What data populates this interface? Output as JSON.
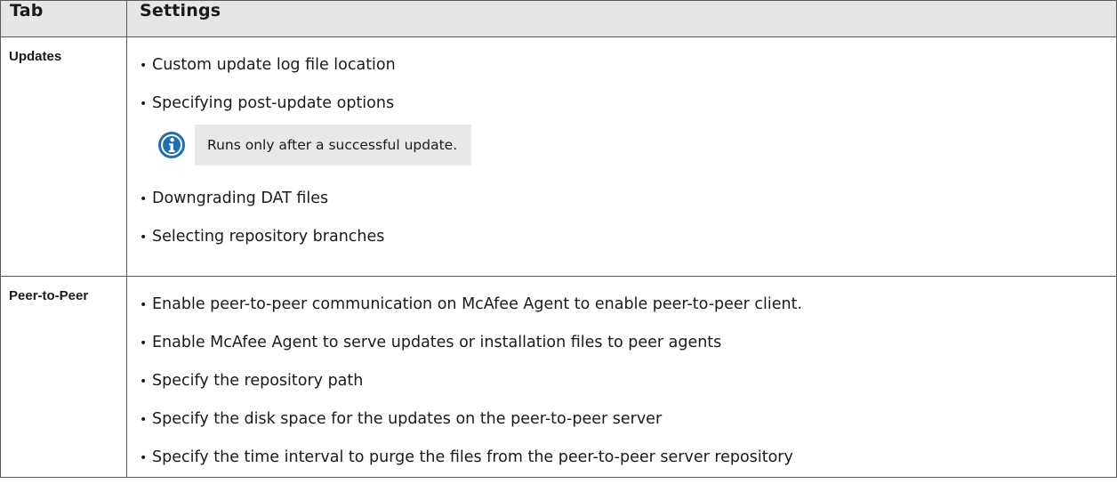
{
  "table": {
    "headers": {
      "tab": "Tab",
      "settings": "Settings"
    },
    "rows": [
      {
        "tab": "Updates",
        "items": [
          "Custom update log file location",
          "Specifying post-update options",
          "Downgrading DAT files",
          "Selecting repository branches"
        ],
        "note": {
          "icon": "info-icon",
          "text": "Runs only after a successful update."
        }
      },
      {
        "tab": "Peer-to-Peer",
        "items": [
          "Enable peer-to-peer communication on McAfee Agent to enable peer-to-peer client.",
          "Enable McAfee Agent to serve updates or installation files to peer agents",
          "Specify the repository path",
          "Specify the disk space for the updates on the peer-to-peer server",
          "Specify the time interval to purge the files from the peer-to-peer server repository"
        ]
      }
    ]
  },
  "colors": {
    "header_bg": "#e6e6e6",
    "note_bg": "#e8e8e8",
    "info_icon": "#1f6fb6",
    "border": "#5a5a5a"
  }
}
